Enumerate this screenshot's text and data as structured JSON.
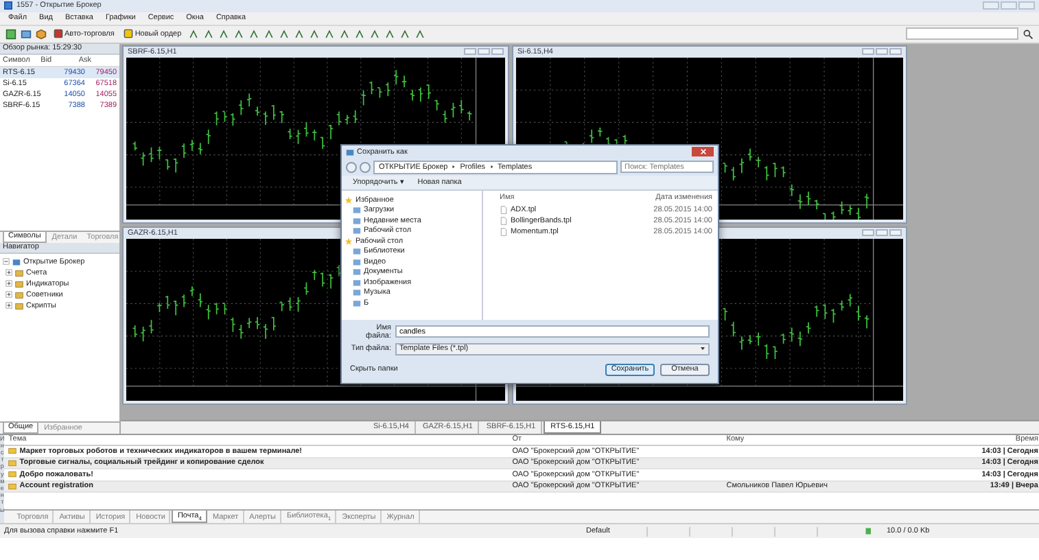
{
  "window": {
    "title": "1557 - Открытие Брокер"
  },
  "menu": [
    "Файл",
    "Вид",
    "Вставка",
    "Графики",
    "Сервис",
    "Окна",
    "Справка"
  ],
  "toolbar_buttons": [
    "Авто-торговля",
    "Новый ордер"
  ],
  "market_watch": {
    "title": "Обзор рынка: 15:29:30",
    "columns": [
      "Символ",
      "Bid",
      "Ask"
    ],
    "rows": [
      {
        "symbol": "RTS-6.15",
        "bid": "79430",
        "ask": "79450",
        "selected": true
      },
      {
        "symbol": "Si-6.15",
        "bid": "67364",
        "ask": "67518",
        "selected": false
      },
      {
        "symbol": "GAZR-6.15",
        "bid": "14050",
        "ask": "14055",
        "selected": false
      },
      {
        "symbol": "SBRF-6.15",
        "bid": "7388",
        "ask": "7389",
        "selected": false
      }
    ],
    "tabs": [
      {
        "label": "Символы",
        "selected": true
      },
      {
        "label": "Детали",
        "selected": false
      },
      {
        "label": "Торговля",
        "selected": false
      }
    ]
  },
  "navigator": {
    "title": "Навигатор",
    "root": {
      "label": "Открытие Брокер",
      "expanded": true,
      "children": [
        "Счета",
        "Индикаторы",
        "Советники",
        "Скрипты"
      ]
    },
    "tabs": [
      {
        "label": "Общие",
        "selected": true
      },
      {
        "label": "Избранное",
        "selected": false
      }
    ]
  },
  "charts": [
    {
      "title": "SBRF-6.15,H1"
    },
    {
      "title": "Si-6.15,H4"
    },
    {
      "title": "GAZR-6.15,H1"
    }
  ],
  "chart_tabs": [
    {
      "label": "Si-6.15,H4",
      "selected": false
    },
    {
      "label": "GAZR-6.15,H1",
      "selected": false
    },
    {
      "label": "SBRF-6.15,H1",
      "selected": false
    },
    {
      "label": "RTS-6.15,H1",
      "selected": true
    }
  ],
  "dialog": {
    "title": "Сохранить как",
    "path": [
      "ОТКРЫТИЕ Брокер",
      "Profiles",
      "Templates"
    ],
    "search": {
      "placeholder": "Поиск: Templates"
    },
    "toolbar": [
      "Упорядочить ▾",
      "Новая папка"
    ],
    "sidebar": [
      {
        "label": "Избранное",
        "children": [
          "Загрузки",
          "Недавние места",
          "Рабочий стол"
        ]
      },
      {
        "label": "Рабочий стол",
        "children": [
          "Библиотеки",
          "Видео",
          "Документы",
          "Изображения",
          "Музыка",
          "Б"
        ]
      }
    ],
    "columns": [
      "Имя",
      "Дата изменения"
    ],
    "files": [
      {
        "name": "ADX.tpl",
        "date": "28.05.2015 14:00"
      },
      {
        "name": "BollingerBands.tpl",
        "date": "28.05.2015 14:00"
      },
      {
        "name": "Momentum.tpl",
        "date": "28.05.2015 14:00"
      }
    ],
    "filename_label": "Имя файла:",
    "filename": "candles",
    "type_label": "Тип файла:",
    "type": "Template Files (*.tpl)",
    "hide_folders": "Скрыть папки",
    "save": "Сохранить",
    "cancel": "Отмена"
  },
  "mail": {
    "columns": [
      "Тема",
      "От",
      "Кому",
      "Время"
    ],
    "rows": [
      {
        "subject": "Маркет торговых роботов и технических индикаторов в вашем терминале!",
        "from": "ОАО \"Брокерский дом \"ОТКРЫТИЕ\"",
        "to": "",
        "time": "14:03 | Сегодня"
      },
      {
        "subject": "Торговые сигналы, социальный трейдинг и копирование сделок",
        "from": "ОАО \"Брокерский дом \"ОТКРЫТИЕ\"",
        "to": "",
        "time": "14:03 | Сегодня"
      },
      {
        "subject": "Добро пожаловать!",
        "from": "ОАО \"Брокерский дом \"ОТКРЫТИЕ\"",
        "to": "",
        "time": "14:03 | Сегодня"
      },
      {
        "subject": "Account registration",
        "from": "ОАО \"Брокерский дом \"ОТКРЫТИЕ\"",
        "to": "Смольников Павел Юрьевич",
        "time": "13:49 | Вчера"
      }
    ]
  },
  "toolbox": {
    "side_label": "Инструменты",
    "tabs": [
      {
        "label": "Торговля",
        "selected": false
      },
      {
        "label": "Активы",
        "selected": false
      },
      {
        "label": "История",
        "selected": false
      },
      {
        "label": "Новости",
        "selected": false
      },
      {
        "label": "Почта",
        "count": "4",
        "selected": true
      },
      {
        "label": "Маркет",
        "selected": false
      },
      {
        "label": "Алерты",
        "selected": false
      },
      {
        "label": "Библиотека",
        "count": "1",
        "selected": false
      },
      {
        "label": "Эксперты",
        "selected": false
      },
      {
        "label": "Журнал",
        "selected": false
      }
    ]
  },
  "status_bar": {
    "help": "Для вызова справки нажмите F1",
    "profile": "Default",
    "traffic": "10.0 / 0.0 Kb"
  }
}
